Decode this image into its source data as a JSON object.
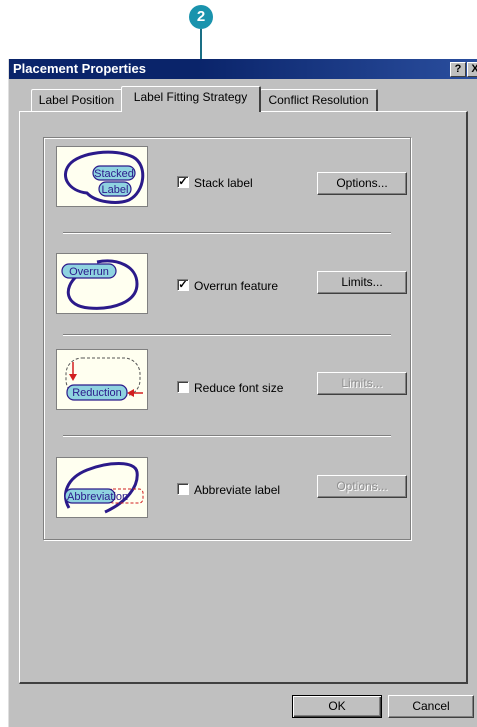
{
  "callout": {
    "number": "2"
  },
  "dialog": {
    "title": "Placement Properties",
    "help_button": "?",
    "close_button": "X"
  },
  "tabs": [
    {
      "label": "Label Position",
      "active": false
    },
    {
      "label": "Label Fitting Strategy",
      "active": true
    },
    {
      "label": "Conflict Resolution",
      "active": false
    }
  ],
  "options": [
    {
      "illustration": [
        "Stacked",
        "Label"
      ],
      "checkbox_label": "Stack label",
      "checked": true,
      "button": "Options...",
      "button_enabled": true
    },
    {
      "illustration": [
        "Overrun"
      ],
      "checkbox_label": "Overrun feature",
      "checked": true,
      "button": "Limits...",
      "button_enabled": true
    },
    {
      "illustration": [
        "Reduction"
      ],
      "checkbox_label": "Reduce font size",
      "checked": false,
      "button": "Limits...",
      "button_enabled": false
    },
    {
      "illustration": [
        "Abbreviation"
      ],
      "checkbox_label": "Abbreviate label",
      "checked": false,
      "button": "Options...",
      "button_enabled": false
    }
  ],
  "footer": {
    "ok": "OK",
    "cancel": "Cancel"
  },
  "colors": {
    "titlebar": "#0a246a",
    "face": "#c0c0c0",
    "callout": "#1a93ad",
    "illustration_stroke": "#2b1a8a",
    "illustration_fill": "#8fd3e0",
    "arrow": "#d21f1f"
  }
}
